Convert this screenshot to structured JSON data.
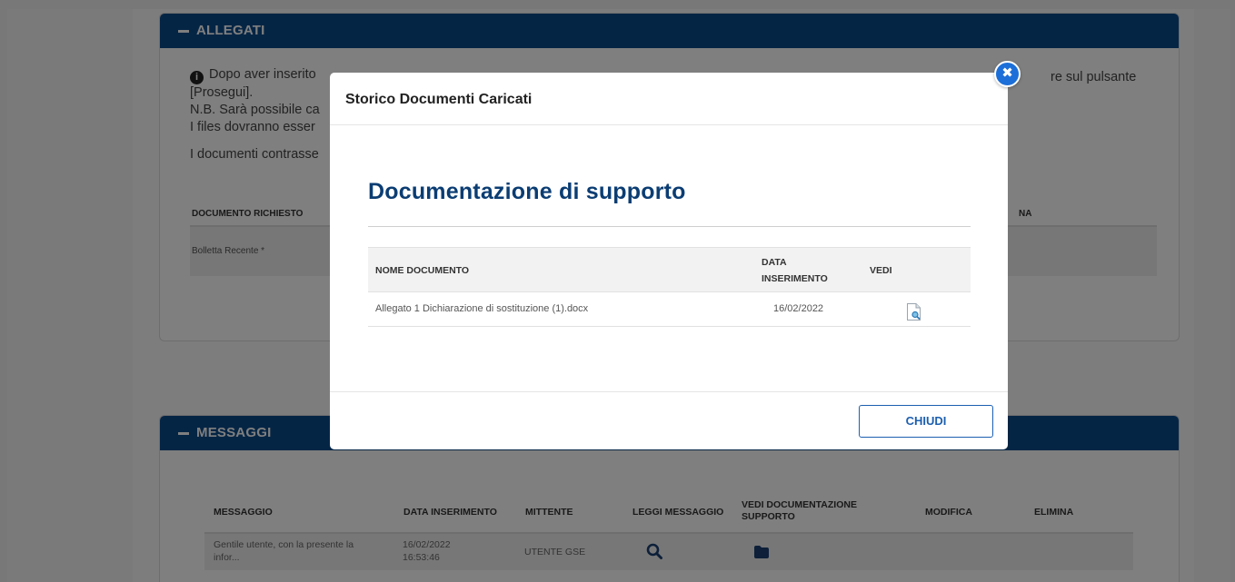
{
  "allegati": {
    "header": "ALLEGATI",
    "line1": "Dopo aver inserito",
    "line1_tail": "re sul pulsante",
    "line2": "[Prosegui].",
    "line3": "N.B. Sarà possibile ca",
    "line4": "I files dovranno esser",
    "line5": "I documenti contrasse",
    "col_documento": "DOCUMENTO RICHIESTO",
    "col_elimina_partial": "NA",
    "row_documento": "Bolletta Recente *"
  },
  "messaggi": {
    "header": "MESSAGGI",
    "columns": {
      "messaggio": "MESSAGGIO",
      "data": "DATA INSERIMENTO",
      "mittente": "MITTENTE",
      "leggi": "LEGGI MESSAGGIO",
      "vedi_doc_1": "VEDI DOCUMENTAZIONE",
      "vedi_doc_2": "SUPPORTO",
      "modifica": "MODIFICA",
      "elimina": "ELIMINA"
    },
    "rows": [
      {
        "messaggio_1": "Gentile utente, con la presente la",
        "messaggio_2": "infor...",
        "data_1": "16/02/2022",
        "data_2": "16:53:46",
        "mittente": "UTENTE GSE"
      }
    ]
  },
  "modal": {
    "title": "Storico Documenti Caricati",
    "section_title": "Documentazione di supporto",
    "close_icon": "close-icon",
    "columns": {
      "nome": "NOME DOCUMENTO",
      "data_1": "DATA",
      "data_2": "INSERIMENTO",
      "vedi": "VEDI"
    },
    "rows": [
      {
        "nome": "Allegato 1 Dichiarazione di sostituzione (1).docx",
        "data": "16/02/2022",
        "icon": "document-preview-icon"
      }
    ],
    "button_close": "CHIUDI"
  },
  "colors": {
    "header_blue": "#0a4a8a",
    "title_blue": "#0b3d73",
    "accent_blue": "#1c6fd8"
  }
}
